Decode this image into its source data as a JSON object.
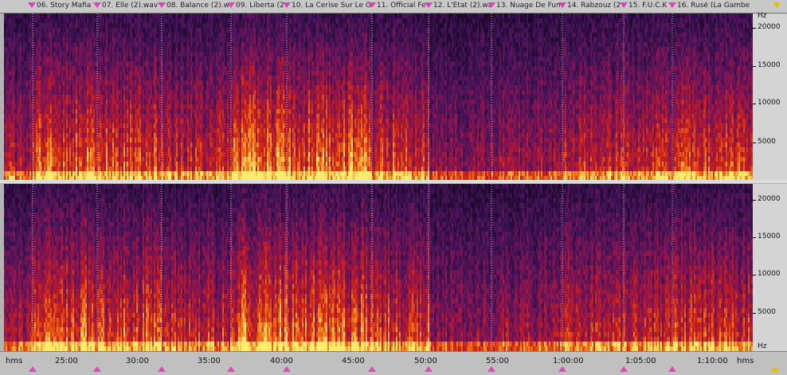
{
  "window": {
    "title": ""
  },
  "track_markers": [
    {
      "label": "06. Story Mafia"
    },
    {
      "label": "07. Elle (2).wav"
    },
    {
      "label": "08. Balance (2).wa"
    },
    {
      "label": "09. Liberta (2"
    },
    {
      "label": "10. La Cerise Sur Le G"
    },
    {
      "label": "11. Official Fe"
    },
    {
      "label": "12. L'Etat (2).wa"
    },
    {
      "label": "13. Nuage De Fum"
    },
    {
      "label": "14. Rabzouz (2"
    },
    {
      "label": "15. F.U.C.K"
    },
    {
      "label": "16. Rusé (La Gambe"
    }
  ],
  "freq_scale": {
    "unit": "Hz",
    "labels": [
      "20000",
      "15000",
      "10000",
      "5000"
    ]
  },
  "time_ruler": {
    "unit": "hms",
    "labels": [
      "25:00",
      "30:00",
      "35:00",
      "40:00",
      "45:00",
      "50:00",
      "55:00",
      "1:00:00",
      "1:05:00",
      "1:10:00"
    ]
  },
  "colors": {
    "spectrogram_low": "#1a0a2e",
    "spectrogram_mid": "#c01818",
    "spectrogram_high": "#ffe060",
    "marker": "#e040c0"
  }
}
